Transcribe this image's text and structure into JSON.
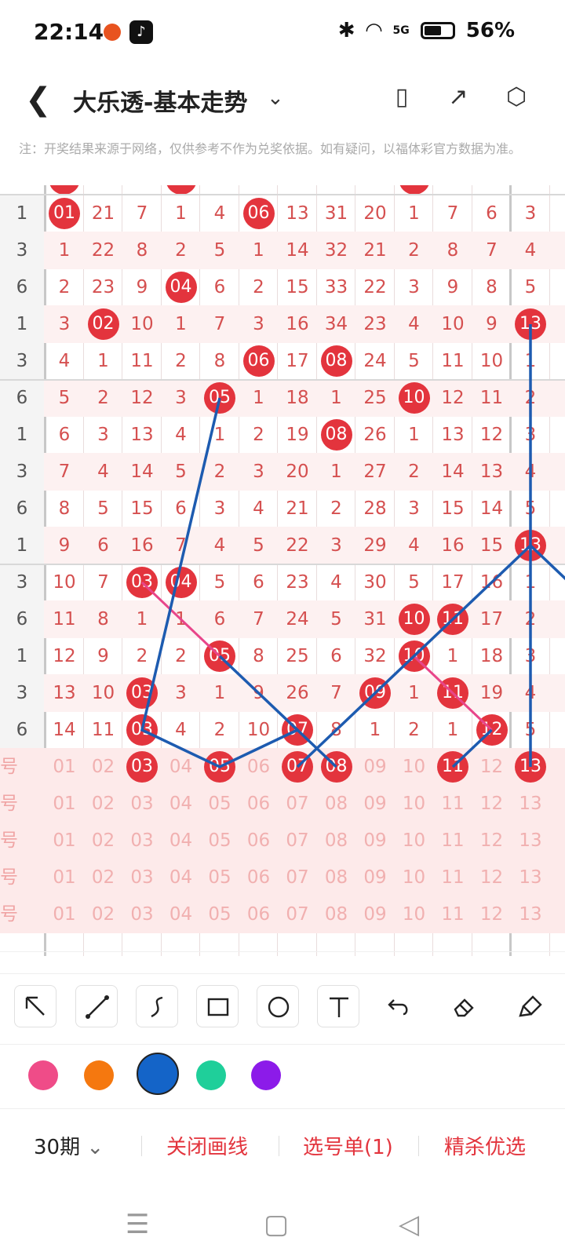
{
  "status_bar": {
    "time": "22:14",
    "battery": "56%",
    "signal": "5G"
  },
  "header": {
    "title": "大乐透-基本走势",
    "back_icon": "chevron-left-icon"
  },
  "notice": "注：开奖结果来源于网络，仅供参考不作为兑奖依据。如有疑问，以福体彩官方数据为准。",
  "grid": {
    "row_labels": [
      "1",
      "3",
      "6",
      "1",
      "3",
      "6",
      "1",
      "3",
      "6",
      "1",
      "3",
      "6",
      "1",
      "3",
      "6"
    ],
    "rows": [
      [
        "01",
        "21",
        "7",
        "1",
        "4",
        "06",
        "13",
        "31",
        "20",
        "1",
        "7",
        "6",
        "3"
      ],
      [
        "1",
        "22",
        "8",
        "2",
        "5",
        "1",
        "14",
        "32",
        "21",
        "2",
        "8",
        "7",
        "4"
      ],
      [
        "2",
        "23",
        "9",
        "04",
        "6",
        "2",
        "15",
        "33",
        "22",
        "3",
        "9",
        "8",
        "5"
      ],
      [
        "3",
        "02",
        "10",
        "1",
        "7",
        "3",
        "16",
        "34",
        "23",
        "4",
        "10",
        "9",
        "13"
      ],
      [
        "4",
        "1",
        "11",
        "2",
        "8",
        "06",
        "17",
        "08",
        "24",
        "5",
        "11",
        "10",
        "1"
      ],
      [
        "5",
        "2",
        "12",
        "3",
        "05",
        "1",
        "18",
        "1",
        "25",
        "10",
        "12",
        "11",
        "2"
      ],
      [
        "6",
        "3",
        "13",
        "4",
        "1",
        "2",
        "19",
        "08",
        "26",
        "1",
        "13",
        "12",
        "3"
      ],
      [
        "7",
        "4",
        "14",
        "5",
        "2",
        "3",
        "20",
        "1",
        "27",
        "2",
        "14",
        "13",
        "4"
      ],
      [
        "8",
        "5",
        "15",
        "6",
        "3",
        "4",
        "21",
        "2",
        "28",
        "3",
        "15",
        "14",
        "5"
      ],
      [
        "9",
        "6",
        "16",
        "7",
        "4",
        "5",
        "22",
        "3",
        "29",
        "4",
        "16",
        "15",
        "13"
      ],
      [
        "10",
        "7",
        "03",
        "04",
        "5",
        "6",
        "23",
        "4",
        "30",
        "5",
        "17",
        "16",
        "1"
      ],
      [
        "11",
        "8",
        "1",
        "1",
        "6",
        "7",
        "24",
        "5",
        "31",
        "10",
        "11",
        "17",
        "2"
      ],
      [
        "12",
        "9",
        "2",
        "2",
        "05",
        "8",
        "25",
        "6",
        "32",
        "10",
        "1",
        "18",
        "3"
      ],
      [
        "13",
        "10",
        "03",
        "3",
        "1",
        "9",
        "26",
        "7",
        "09",
        "1",
        "11",
        "19",
        "4"
      ],
      [
        "14",
        "11",
        "03",
        "4",
        "2",
        "10",
        "07",
        "8",
        "1",
        "2",
        "1",
        "12",
        "5"
      ]
    ],
    "hits": [
      [
        true,
        false,
        false,
        false,
        false,
        true,
        false,
        false,
        false,
        false,
        false,
        false,
        false
      ],
      [
        false,
        false,
        false,
        false,
        false,
        false,
        false,
        false,
        false,
        false,
        false,
        false,
        false
      ],
      [
        false,
        false,
        false,
        true,
        false,
        false,
        false,
        false,
        false,
        false,
        false,
        false,
        false
      ],
      [
        false,
        true,
        false,
        false,
        false,
        false,
        false,
        false,
        false,
        false,
        false,
        false,
        true
      ],
      [
        false,
        false,
        false,
        false,
        false,
        true,
        false,
        true,
        false,
        false,
        false,
        false,
        false
      ],
      [
        false,
        false,
        false,
        false,
        true,
        false,
        false,
        false,
        false,
        true,
        false,
        false,
        false
      ],
      [
        false,
        false,
        false,
        false,
        false,
        false,
        false,
        true,
        false,
        false,
        false,
        false,
        false
      ],
      [
        false,
        false,
        false,
        false,
        false,
        false,
        false,
        false,
        false,
        false,
        false,
        false,
        false
      ],
      [
        false,
        false,
        false,
        false,
        false,
        false,
        false,
        false,
        false,
        false,
        false,
        false,
        false
      ],
      [
        false,
        false,
        false,
        false,
        false,
        false,
        false,
        false,
        false,
        false,
        false,
        false,
        true
      ],
      [
        false,
        false,
        true,
        true,
        false,
        false,
        false,
        false,
        false,
        false,
        false,
        false,
        false
      ],
      [
        false,
        false,
        false,
        false,
        false,
        false,
        false,
        false,
        false,
        true,
        true,
        false,
        false
      ],
      [
        false,
        false,
        false,
        false,
        true,
        false,
        false,
        false,
        false,
        true,
        false,
        false,
        false
      ],
      [
        false,
        false,
        true,
        false,
        false,
        false,
        false,
        false,
        true,
        false,
        true,
        false,
        false
      ],
      [
        false,
        false,
        true,
        false,
        false,
        false,
        true,
        false,
        false,
        false,
        false,
        true,
        false
      ]
    ],
    "future_label": "号",
    "future_numbers": [
      "01",
      "02",
      "03",
      "04",
      "05",
      "06",
      "07",
      "08",
      "09",
      "10",
      "11",
      "12",
      "13"
    ],
    "selected_numbers": [
      "03",
      "05",
      "07",
      "08",
      "11",
      "13"
    ]
  },
  "tools": [
    "arrow-tool-icon",
    "line-tool-icon",
    "curve-tool-icon",
    "rect-tool-icon",
    "circle-tool-icon",
    "text-tool-icon",
    "undo-icon",
    "eraser-icon",
    "clear-brush-icon"
  ],
  "colors": [
    "#ef4c88",
    "#f5780f",
    "#1464c8",
    "#1fcf9a",
    "#8c1be9"
  ],
  "bottom_bar": {
    "period": "30期",
    "close_drawing": "关闭画线",
    "ticket": "选号单(1)",
    "premium": "精杀优选"
  }
}
